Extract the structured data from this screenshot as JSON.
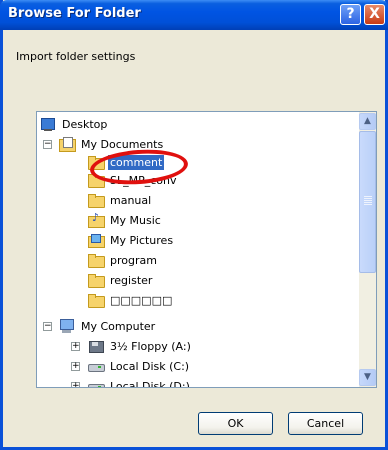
{
  "window": {
    "title": "Browse For Folder",
    "help_glyph": "?",
    "close_glyph": "X"
  },
  "instruction": "Import folder settings",
  "tree": {
    "desktop": "Desktop",
    "my_documents": "My Documents",
    "comment": "comment",
    "sl_folder": "SL_MP_conv",
    "manual": "manual",
    "my_music": "My Music",
    "my_pictures": "My Pictures",
    "program": "program",
    "register": "register",
    "unnamed": "□□□□□□",
    "my_computer": "My Computer",
    "floppy": "3½ Floppy (A:)",
    "local_c": "Local Disk (C:)",
    "local_d": "Local Disk (D:)",
    "expand_minus": "−",
    "expand_plus": "+",
    "selected_item": "comment"
  },
  "scrollbar": {
    "up": "▲",
    "down": "▼"
  },
  "buttons": {
    "ok": "OK",
    "cancel": "Cancel"
  },
  "colors": {
    "titlebar": "#0054e3",
    "selection": "#316ac5",
    "annotation": "#e0100e"
  }
}
